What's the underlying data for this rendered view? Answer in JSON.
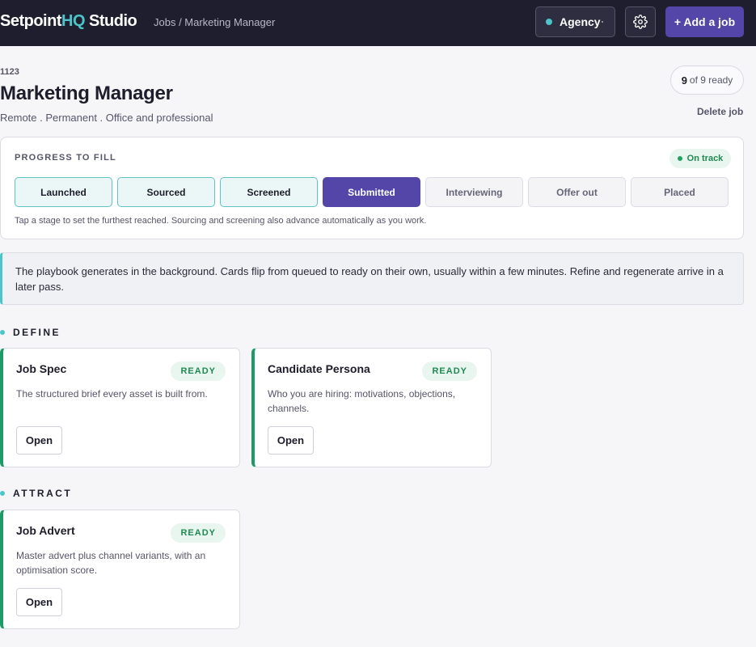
{
  "header": {
    "brand_main": "Setpoint",
    "brand_accent": "HQ",
    "brand_suffix": " Studio",
    "breadcrumb": "Jobs / Marketing Manager",
    "agency_label": "Agency",
    "settings_icon": "gear-icon",
    "add_job_label": "+ Add a job"
  },
  "job": {
    "id": "1123",
    "title": "Marketing Manager",
    "meta": "Remote . Permanent . Office and professional",
    "ready_count": "9",
    "ready_suffix": "of 9 ready",
    "delete_label": "Delete job"
  },
  "progress": {
    "label": "PROGRESS TO FILL",
    "status": "On track",
    "stages": [
      "Launched",
      "Sourced",
      "Screened",
      "Submitted",
      "Interviewing",
      "Offer out",
      "Placed"
    ],
    "current_stage_index": 3,
    "hint": "Tap a stage to set the furthest reached. Sourcing and screening also advance automatically as you work."
  },
  "banner": {
    "text": "The playbook generates in the background. Cards flip from queued to ready on their own, usually within a few minutes. Refine and regenerate arrive in a later pass."
  },
  "sections": [
    {
      "title": "DEFINE",
      "cards": [
        {
          "title": "Job Spec",
          "badge": "READY",
          "desc": "The structured brief every asset is built from.",
          "action": "Open"
        },
        {
          "title": "Candidate Persona",
          "badge": "READY",
          "desc": "Who you are hiring: motivations, objections, channels.",
          "action": "Open"
        }
      ]
    },
    {
      "title": "ATTRACT",
      "cards": [
        {
          "title": "Job Advert",
          "badge": "READY",
          "desc": "Master advert plus channel variants, with an optimisation score.",
          "action": "Open"
        }
      ]
    }
  ],
  "colors": {
    "accent": "#5346a8",
    "teal": "#4cc4c9",
    "ready_green": "#1e8a52",
    "header_bg": "#1e1e2e"
  }
}
